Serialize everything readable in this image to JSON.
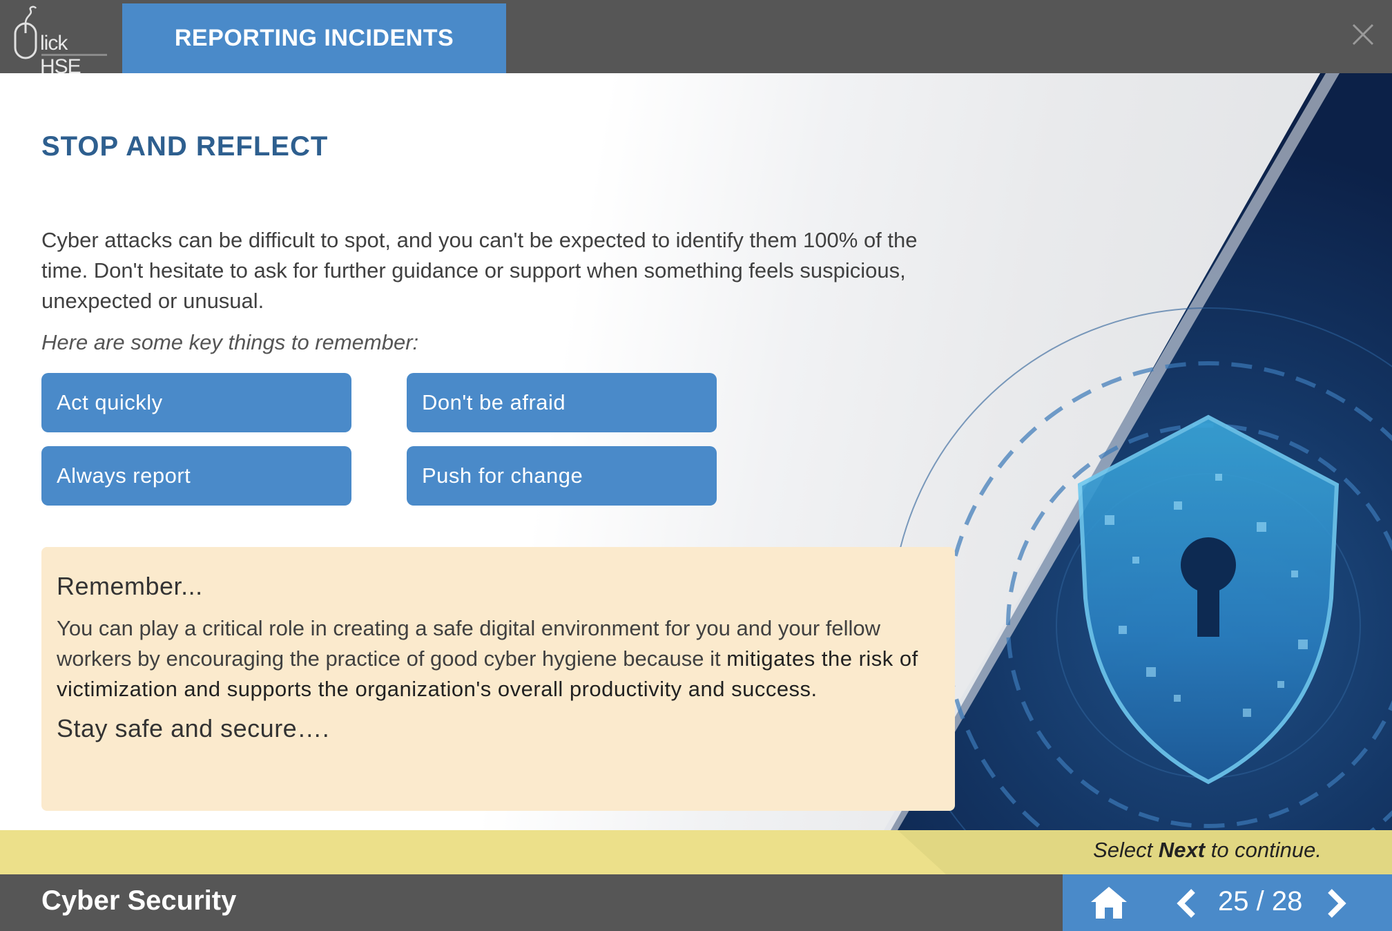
{
  "app": {
    "logo_text": "lick HSE",
    "tab_title": "REPORTING INCIDENTS",
    "close_icon": "close-icon"
  },
  "slide": {
    "heading": "STOP AND REFLECT",
    "paragraph": "Cyber attacks can be difficult to spot, and you can't be expected to identify them 100% of the time. Don't hesitate to ask for further guidance or support when something feels suspicious, unexpected or unusual.",
    "intro_italic": "Here are some key things to remember:",
    "key_buttons": [
      {
        "label": "Act quickly"
      },
      {
        "label": "Don't be afraid"
      },
      {
        "label": "Always report"
      },
      {
        "label": "Push for change"
      }
    ],
    "remember": {
      "title": "Remember...",
      "body_start": "You can play a critical role in creating a safe digital environment for you and your fellow workers by encouraging the practice of good cyber hygiene because it ",
      "body_emphasis": "mitigates the risk of victimization and supports the organization's overall productivity and success.",
      "closing": "Stay safe and secure…."
    },
    "image": "cyber-shield-lock-illustration"
  },
  "footer": {
    "hint_prefix": "Select ",
    "hint_bold": "Next",
    "hint_suffix": " to continue.",
    "course_title": "Cyber Security",
    "page_indicator": "25 / 28",
    "home_icon": "home-icon",
    "prev_icon": "chevron-left-icon",
    "next_icon": "chevron-right-icon"
  },
  "colors": {
    "accent_blue": "#4a8ac9",
    "heading_blue": "#2e5f8f",
    "bar_gray": "#565656",
    "note_bg": "#fbeacd",
    "hint_bar": "#ece08a"
  }
}
